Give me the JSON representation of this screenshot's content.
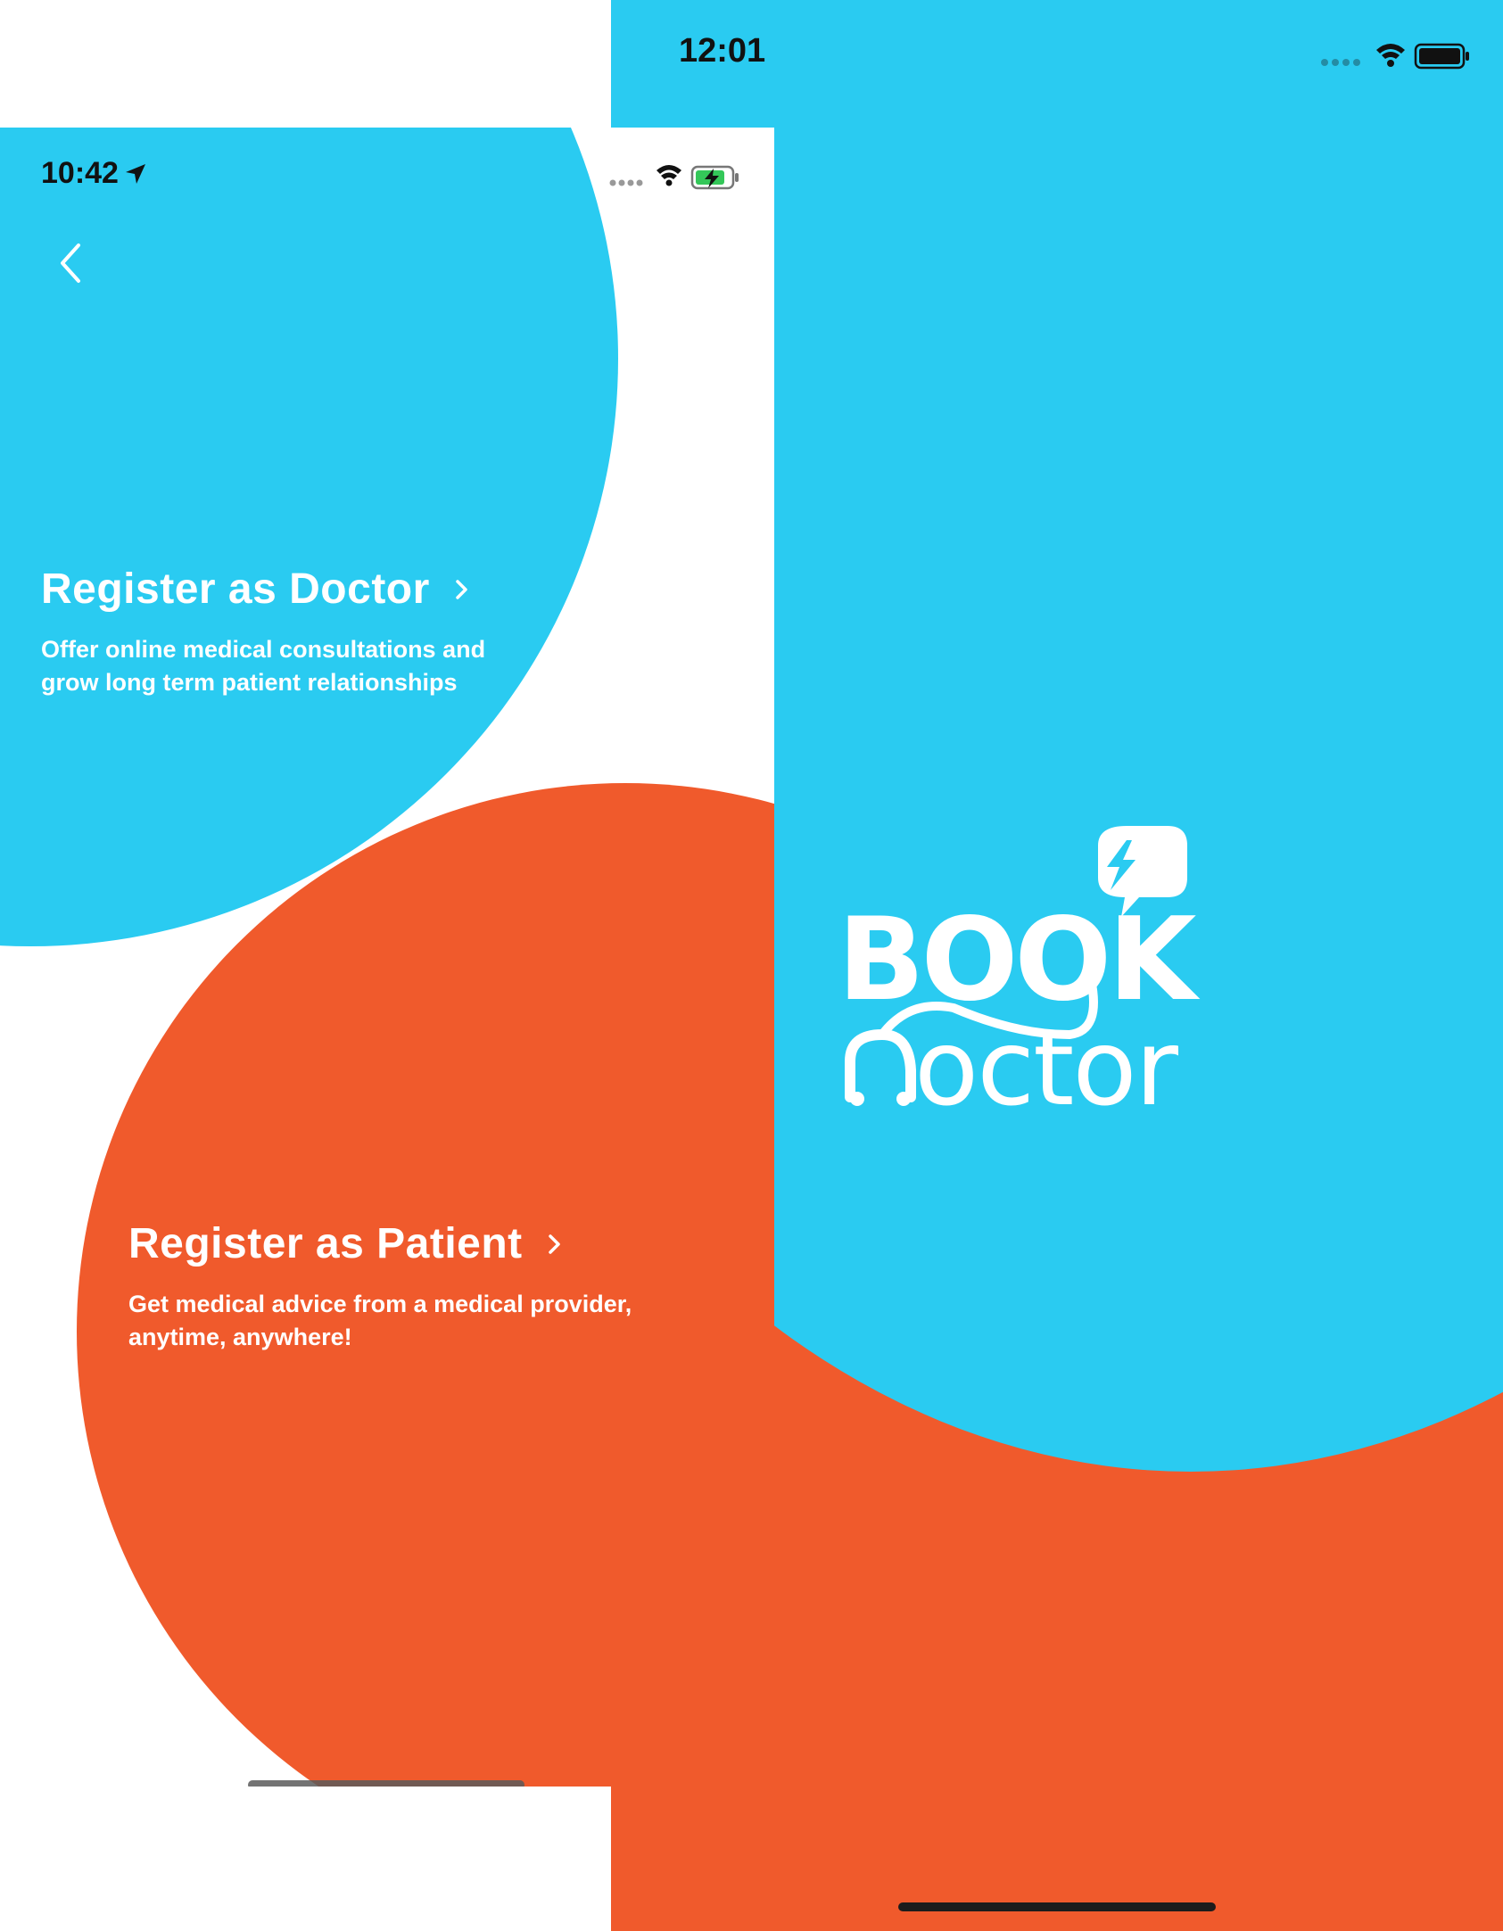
{
  "colors": {
    "brand_blue": "#2ACBF1",
    "brand_orange": "#F05A2C",
    "white": "#FFFFFF"
  },
  "splash": {
    "status_bar": {
      "time": "12:01"
    },
    "logo": {
      "word_top": "BOOK",
      "word_bottom": "octor",
      "icon": "lightning-chat-bubble-icon"
    }
  },
  "register": {
    "status_bar": {
      "time": "10:42"
    },
    "back_icon": "chevron-left-icon",
    "doctor": {
      "title": "Register as Doctor",
      "description": "Offer online medical consultations and\ngrow long term patient relationships"
    },
    "patient": {
      "title": "Register as Patient",
      "description": "Get medical advice from a medical provider,\nanytime, anywhere!"
    }
  }
}
